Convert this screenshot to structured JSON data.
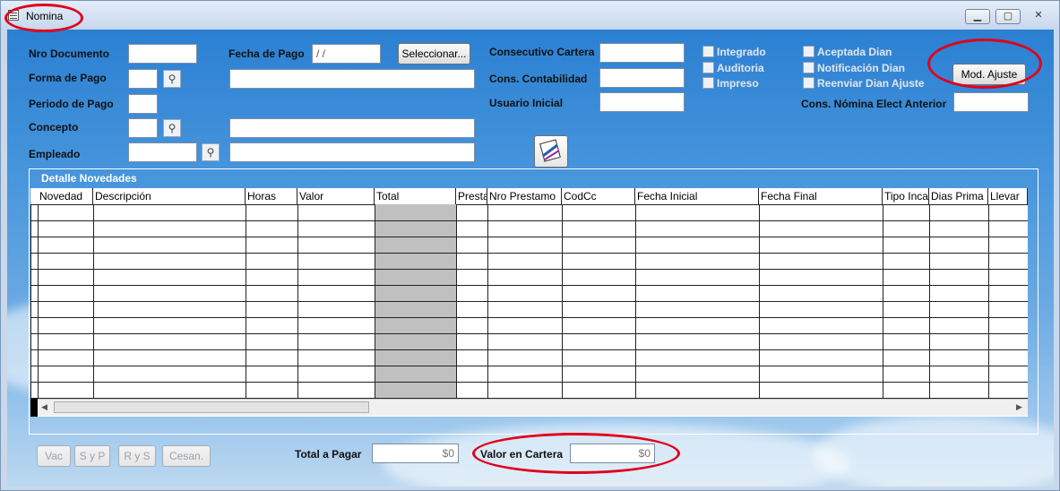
{
  "window": {
    "title": "Nomina"
  },
  "form": {
    "nro_documento_label": "Nro Documento",
    "forma_pago_label": "Forma de Pago",
    "periodo_pago_label": "Periodo de Pago",
    "concepto_label": "Concepto",
    "empleado_label": "Empleado",
    "fecha_pago_label": "Fecha de Pago",
    "fecha_pago_value": " / /",
    "seleccionar_label": "Seleccionar...",
    "consecutivo_cartera_label": "Consecutivo Cartera",
    "cons_contabilidad_label": "Cons. Contabilidad",
    "usuario_inicial_label": "Usuario Inicial",
    "cons_nomina_anterior_label": "Cons. Nómina Elect Anterior",
    "mod_ajuste_label": "Mod. Ajuste"
  },
  "checkboxes": {
    "integrado": "Integrado",
    "auditoria": "Auditoria",
    "impreso": "Impreso",
    "aceptada_dian": "Aceptada Dian",
    "notificacion_dian": "Notificación Dian",
    "reenviar_dian": "Reenviar Dian Ajuste"
  },
  "grid": {
    "title": "Detalle Novedades",
    "columns": [
      "Novedad",
      "Descripción",
      "Horas",
      "Valor",
      "Total",
      "Presta",
      "Nro Prestamo",
      "CodCc",
      "Fecha Inicial",
      "Fecha Final",
      "Tipo Inca",
      "Dias Prima",
      "Llevar"
    ]
  },
  "footer": {
    "vac": "Vac",
    "syp": "S y P",
    "rys": "R y S",
    "cesan": "Cesan.",
    "total_pagar_label": "Total a Pagar",
    "total_pagar_value": "$0",
    "valor_cartera_label": "Valor en Cartera",
    "valor_cartera_value": "$0"
  },
  "colors": {
    "annotation": "#e0001a",
    "sky": "#3a8ad8"
  }
}
